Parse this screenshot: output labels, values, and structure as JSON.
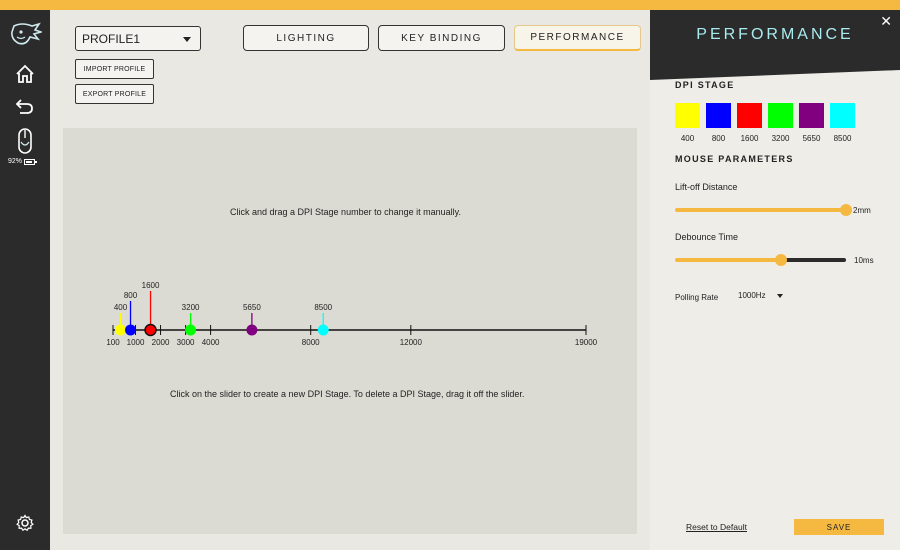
{
  "header": {
    "profile": "PROFILE1",
    "import_label": "IMPORT PROFILE",
    "export_label": "EXPORT PROFILE",
    "tabs": [
      {
        "label": "LIGHTING",
        "active": false
      },
      {
        "label": "KEY BINDING",
        "active": false
      },
      {
        "label": "PERFORMANCE",
        "active": true
      }
    ]
  },
  "sidebar": {
    "battery": "92%",
    "battery_level": 0.92,
    "icons": [
      "logo-icon",
      "home-icon",
      "back-icon",
      "mouse-icon",
      "settings-icon"
    ]
  },
  "dpi_panel": {
    "hint_top": "Click and drag a DPI Stage number to change it manually.",
    "hint_bottom": "Click on the slider to create a new DPI Stage. To delete a DPI Stage, drag it off the slider.",
    "scale_min": 100,
    "scale_max": 19000,
    "ticks": [
      100,
      1000,
      2000,
      3000,
      4000,
      8000,
      12000,
      19000
    ],
    "stages": [
      {
        "value": 400,
        "color": "#ffff00"
      },
      {
        "value": 800,
        "color": "#0000ff"
      },
      {
        "value": 1600,
        "color": "#ff0000",
        "selected": true
      },
      {
        "value": 3200,
        "color": "#00ff00"
      },
      {
        "value": 5650,
        "color": "#800080"
      },
      {
        "value": 8500,
        "color": "#00ffff"
      }
    ]
  },
  "performance": {
    "title": "PERFORMANCE",
    "close": "✕",
    "dpi_stage_title": "DPI STAGE",
    "swatches": [
      {
        "label": "400",
        "color": "#ffff00"
      },
      {
        "label": "800",
        "color": "#0000ff"
      },
      {
        "label": "1600",
        "color": "#ff0000"
      },
      {
        "label": "3200",
        "color": "#00ff00"
      },
      {
        "label": "5650",
        "color": "#800080"
      },
      {
        "label": "8500",
        "color": "#00ffff"
      }
    ],
    "mouse_params_title": "MOUSE PARAMETERS",
    "liftoff_label": "Lift-off Distance",
    "liftoff_value": "2mm",
    "liftoff_fraction": 1.0,
    "debounce_label": "Debounce Time",
    "debounce_value": "10ms",
    "debounce_fraction": 0.62,
    "polling_label": "Polling Rate",
    "polling_value": "1000Hz",
    "reset_label": "Reset to Default",
    "save_label": "SAVE"
  },
  "colors": {
    "accent": "#f5b942",
    "dark": "#2b2b2b",
    "title": "#a9ecf0"
  }
}
